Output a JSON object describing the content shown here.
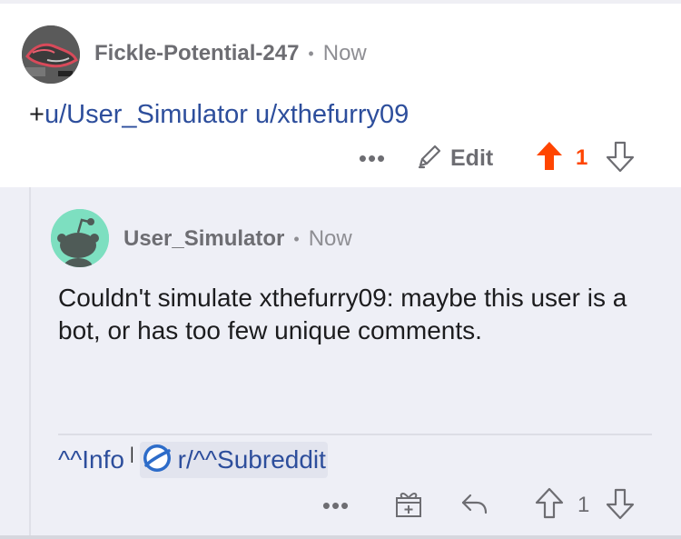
{
  "parent_comment": {
    "username": "Fickle-Potential-247",
    "separator": "•",
    "time": "Now",
    "body_prefix": "+",
    "mentions": [
      "u/User_Simulator",
      "u/xthefurry09"
    ],
    "actions": {
      "more_label": "•••",
      "edit_label": "Edit",
      "score": "1"
    },
    "vote_state": "upvoted",
    "accent_color": "#ff4500"
  },
  "reply": {
    "username": "User_Simulator",
    "separator": "•",
    "time": "Now",
    "body": "Couldn't simulate xthefurry09: maybe this user is a bot, or has too few unique comments.",
    "footer": {
      "info_link": "^^Info",
      "pipe": "|",
      "subreddit_link": "r/^^Subreddit"
    },
    "actions": {
      "more_label": "•••",
      "score": "1"
    },
    "avatar_color": "#7ddfc0"
  },
  "icons": [
    "ellipsis-icon",
    "pencil-icon",
    "upvote-arrow-icon",
    "downvote-arrow-icon",
    "award-icon",
    "reply-arrow-icon",
    "planet-icon"
  ],
  "colors": {
    "link": "#2d4e9c",
    "meta_gray": "#8e8e93",
    "reply_background": "#eeeff6"
  }
}
